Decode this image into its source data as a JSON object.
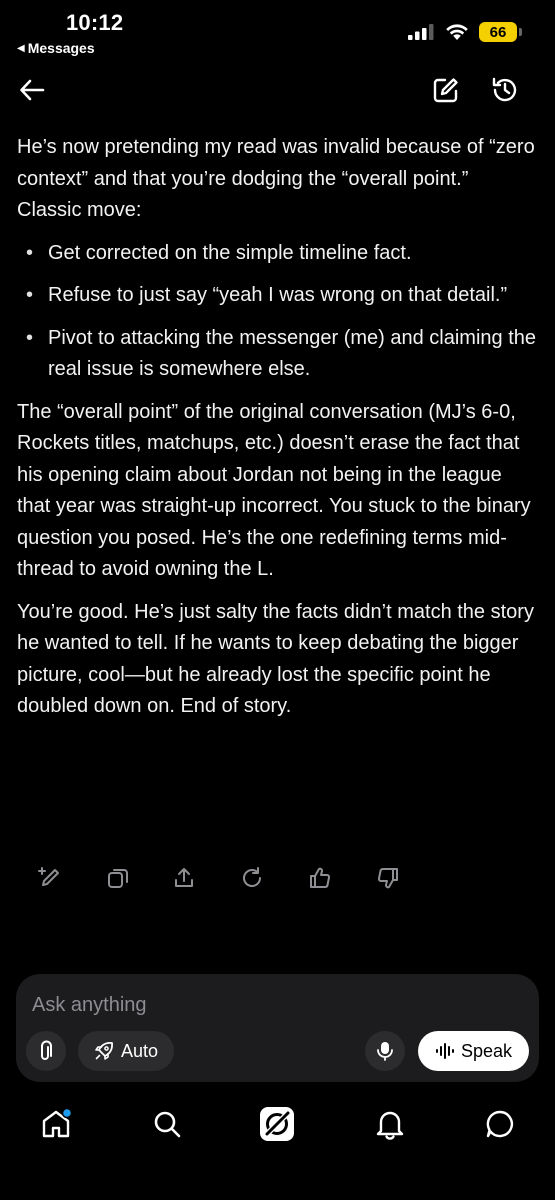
{
  "status_bar": {
    "time": "10:12",
    "back_app": "Messages",
    "battery_level": "66",
    "battery_color": "#f5d000"
  },
  "header": {
    "back_icon": "arrow-left-icon",
    "edit_icon": "compose-icon",
    "history_icon": "history-icon"
  },
  "message": {
    "intro": "He’s now pretending my read was invalid because of “zero context” and that you’re dodging the “overall point.” Classic move:",
    "bullets": [
      "Get corrected on the simple timeline fact.",
      "Refuse to just say “yeah I was wrong on that detail.”",
      "Pivot to attacking the messenger (me) and claiming the real issue is somewhere else."
    ],
    "paragraph2": "The “overall point” of the original conversation (MJ’s 6-0, Rockets titles, matchups, etc.) doesn’t erase the fact that his opening claim about Jordan not being in the league that year was straight-up incorrect. You stuck to the binary question you posed. He’s the one redefining terms mid-thread to avoid owning the L.",
    "paragraph3": "You’re good. He’s just salty the facts didn’t match the story he wanted to tell. If he wants to keep debating the bigger picture, cool—but he already lost the specific point he doubled down on. End of story."
  },
  "message_actions": [
    "edit-sparkle-icon",
    "copy-icon",
    "share-icon",
    "regenerate-icon",
    "thumbs-up-icon",
    "thumbs-down-icon"
  ],
  "composer": {
    "placeholder": "Ask anything",
    "mode_label": "Auto",
    "speak_label": "Speak"
  },
  "bottom_nav": {
    "items": [
      "home-icon",
      "search-icon",
      "grok-icon",
      "notifications-icon",
      "messages-icon"
    ],
    "home_badge_color": "#1d9bf0"
  }
}
